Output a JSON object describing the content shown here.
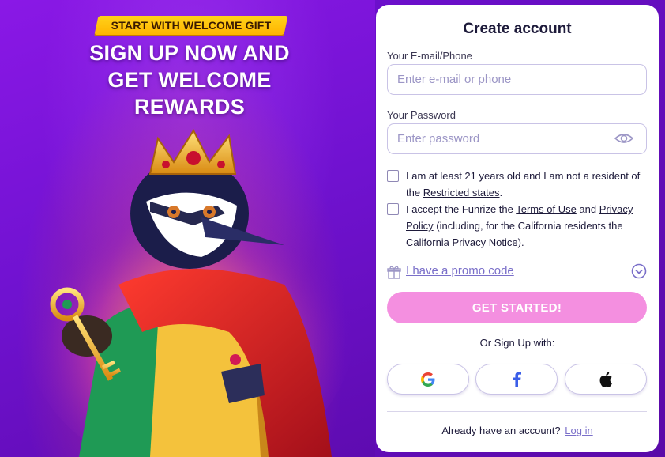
{
  "promo": {
    "badge": "START WITH WELCOME GIFT",
    "headline_line1": "SIGN UP NOW AND",
    "headline_line2": "GET WELCOME",
    "headline_line3": "REWARDS"
  },
  "form": {
    "title": "Create account",
    "email_label": "Your E-mail/Phone",
    "email_placeholder": "Enter e-mail or phone",
    "email_value": "",
    "password_label": "Your Password",
    "password_placeholder": "Enter password",
    "password_value": "",
    "age_check": {
      "checked": false,
      "text_before": "I am at least 21 years old and I am not a resident of the ",
      "link": "Restricted states",
      "text_after": "."
    },
    "terms_check": {
      "checked": false,
      "text_before": "I accept the Funrize the ",
      "link_terms": "Terms of Use",
      "text_mid": " and ",
      "link_privacy": "Privacy Policy",
      "text_mid2": " (including, for the California residents the ",
      "link_ca": "California Privacy Notice",
      "text_after": ")."
    },
    "promo_code_link": "I have a promo code",
    "submit_label": "GET STARTED!",
    "or_signup": "Or Sign Up with:",
    "social": [
      "google-icon",
      "facebook-icon",
      "apple-icon"
    ],
    "login_prompt": "Already have an account?",
    "login_link": "Log in"
  },
  "colors": {
    "background": "#7012d0",
    "badge": "#ffc107",
    "cta": "#f48fe0",
    "link": "#7a6fc9",
    "text": "#1d1a3a"
  }
}
